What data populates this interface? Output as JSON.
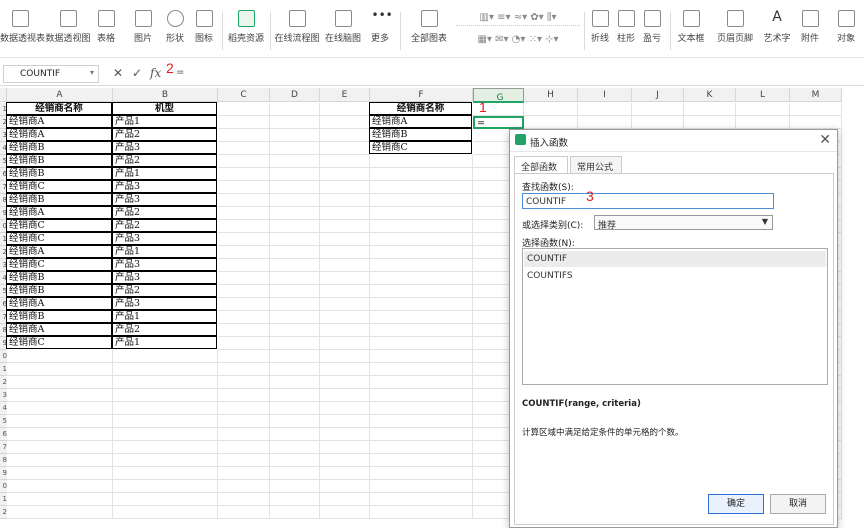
{
  "ribbon": {
    "items": [
      "数据透视表",
      "数据透视图",
      "表格",
      "图片",
      "形状",
      "图标",
      "稻壳资源",
      "在线流程图",
      "在线脑图",
      "更多",
      "全部图表",
      "折线",
      "柱形",
      "盈亏",
      "文本框",
      "页眉页脚",
      "艺术字",
      "附件",
      "对象"
    ]
  },
  "formula_bar": {
    "name_box": "COUNTIF",
    "cancel": "✕",
    "confirm": "✓",
    "fx": "fx",
    "content": "="
  },
  "sheet": {
    "columns": [
      "A",
      "B",
      "C",
      "D",
      "E",
      "F",
      "G",
      "H",
      "I",
      "J",
      "K",
      "L",
      "M"
    ],
    "row_numbers": [
      "1",
      "2",
      "3",
      "4",
      "5",
      "6",
      "7",
      "8",
      "9",
      "0",
      "1",
      "2",
      "3",
      "4",
      "5",
      "6",
      "7",
      "8",
      "9",
      "0",
      "1",
      "2",
      "3",
      "4",
      "5",
      "6",
      "7",
      "8",
      "9",
      "0",
      "1",
      "2"
    ],
    "table_headers": {
      "a": "经销商名称",
      "b": "机型"
    },
    "rows": [
      [
        "经销商A",
        "产品1"
      ],
      [
        "经销商A",
        "产品2"
      ],
      [
        "经销商B",
        "产品3"
      ],
      [
        "经销商B",
        "产品2"
      ],
      [
        "经销商B",
        "产品1"
      ],
      [
        "经销商C",
        "产品3"
      ],
      [
        "经销商B",
        "产品3"
      ],
      [
        "经销商A",
        "产品2"
      ],
      [
        "经销商C",
        "产品2"
      ],
      [
        "经销商C",
        "产品3"
      ],
      [
        "经销商A",
        "产品1"
      ],
      [
        "经销商C",
        "产品3"
      ],
      [
        "经销商B",
        "产品3"
      ],
      [
        "经销商B",
        "产品2"
      ],
      [
        "经销商A",
        "产品3"
      ],
      [
        "经销商B",
        "产品1"
      ],
      [
        "经销商A",
        "产品2"
      ],
      [
        "经销商C",
        "产品1"
      ]
    ],
    "summary_header": "经销商名称",
    "summary_rows": [
      "经销商A",
      "经销商B",
      "经销商C"
    ],
    "active_cell_value": "="
  },
  "annotations": {
    "one": "1",
    "two": "2",
    "three": "3"
  },
  "dialog": {
    "title": "插入函数",
    "close": "✕",
    "tabs": [
      "全部函数",
      "常用公式"
    ],
    "search_label": "查找函数(S):",
    "search_value": "COUNTIF",
    "category_label": "或选择类别(C):",
    "category_value": "推荐",
    "select_label": "选择函数(N):",
    "functions": [
      "COUNTIF",
      "COUNTIFS"
    ],
    "signature": "COUNTIF(range, criteria)",
    "description": "计算区域中满足给定条件的单元格的个数。",
    "ok": "确定",
    "cancel": "取消"
  },
  "colors": {
    "accent": "#21a366",
    "annotation": "#e02020",
    "ok_border": "#2f73d9"
  }
}
